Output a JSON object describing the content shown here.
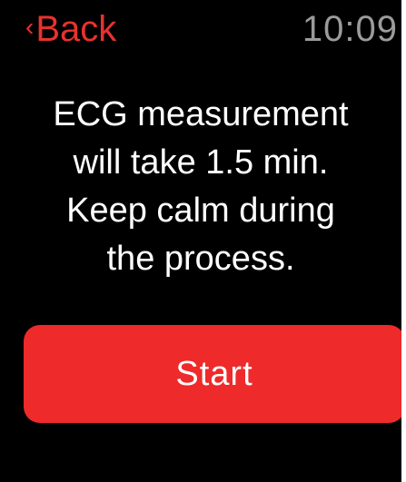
{
  "status_bar": {
    "back_label": "Back",
    "back_icon": "chevron-left-icon",
    "time": "10:09"
  },
  "message": {
    "lines": [
      "ECG measurement",
      "will take 1.5 min.",
      "Keep calm during",
      "the process."
    ]
  },
  "actions": {
    "start_label": "Start"
  },
  "colors": {
    "background": "#000000",
    "accent": "#ee2a2a",
    "back_text": "#e8322e",
    "clock_text": "#9b9b9b",
    "body_text": "#ffffff"
  }
}
